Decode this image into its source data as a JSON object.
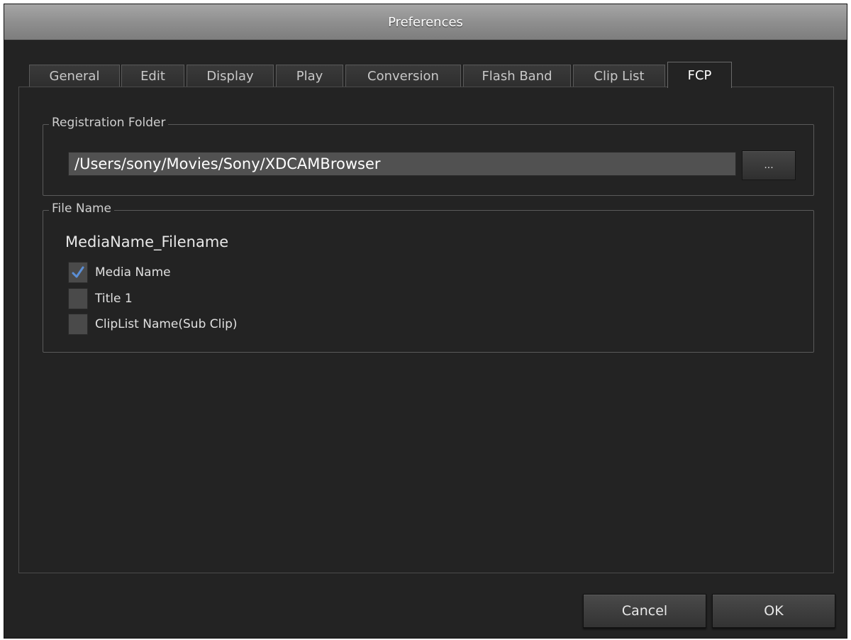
{
  "window": {
    "title": "Preferences"
  },
  "tabs": [
    {
      "label": "General"
    },
    {
      "label": "Edit"
    },
    {
      "label": "Display"
    },
    {
      "label": "Play"
    },
    {
      "label": "Conversion"
    },
    {
      "label": "Flash Band"
    },
    {
      "label": "Clip List"
    },
    {
      "label": "FCP",
      "active": true
    }
  ],
  "registration": {
    "legend": "Registration Folder",
    "path": "/Users/sony/Movies/Sony/XDCAMBrowser",
    "browse_label": "..."
  },
  "file_name": {
    "legend": "File Name",
    "preview": "MediaName_Filename",
    "options": [
      {
        "label": "Media Name",
        "checked": true
      },
      {
        "label": "Title 1",
        "checked": false
      },
      {
        "label": "ClipList Name(Sub Clip)",
        "checked": false
      }
    ]
  },
  "footer": {
    "cancel_label": "Cancel",
    "ok_label": "OK"
  },
  "colors": {
    "window_bg": "#232323",
    "checkmark": "#5b8fd6",
    "titlebar": "#8f8f8f"
  }
}
